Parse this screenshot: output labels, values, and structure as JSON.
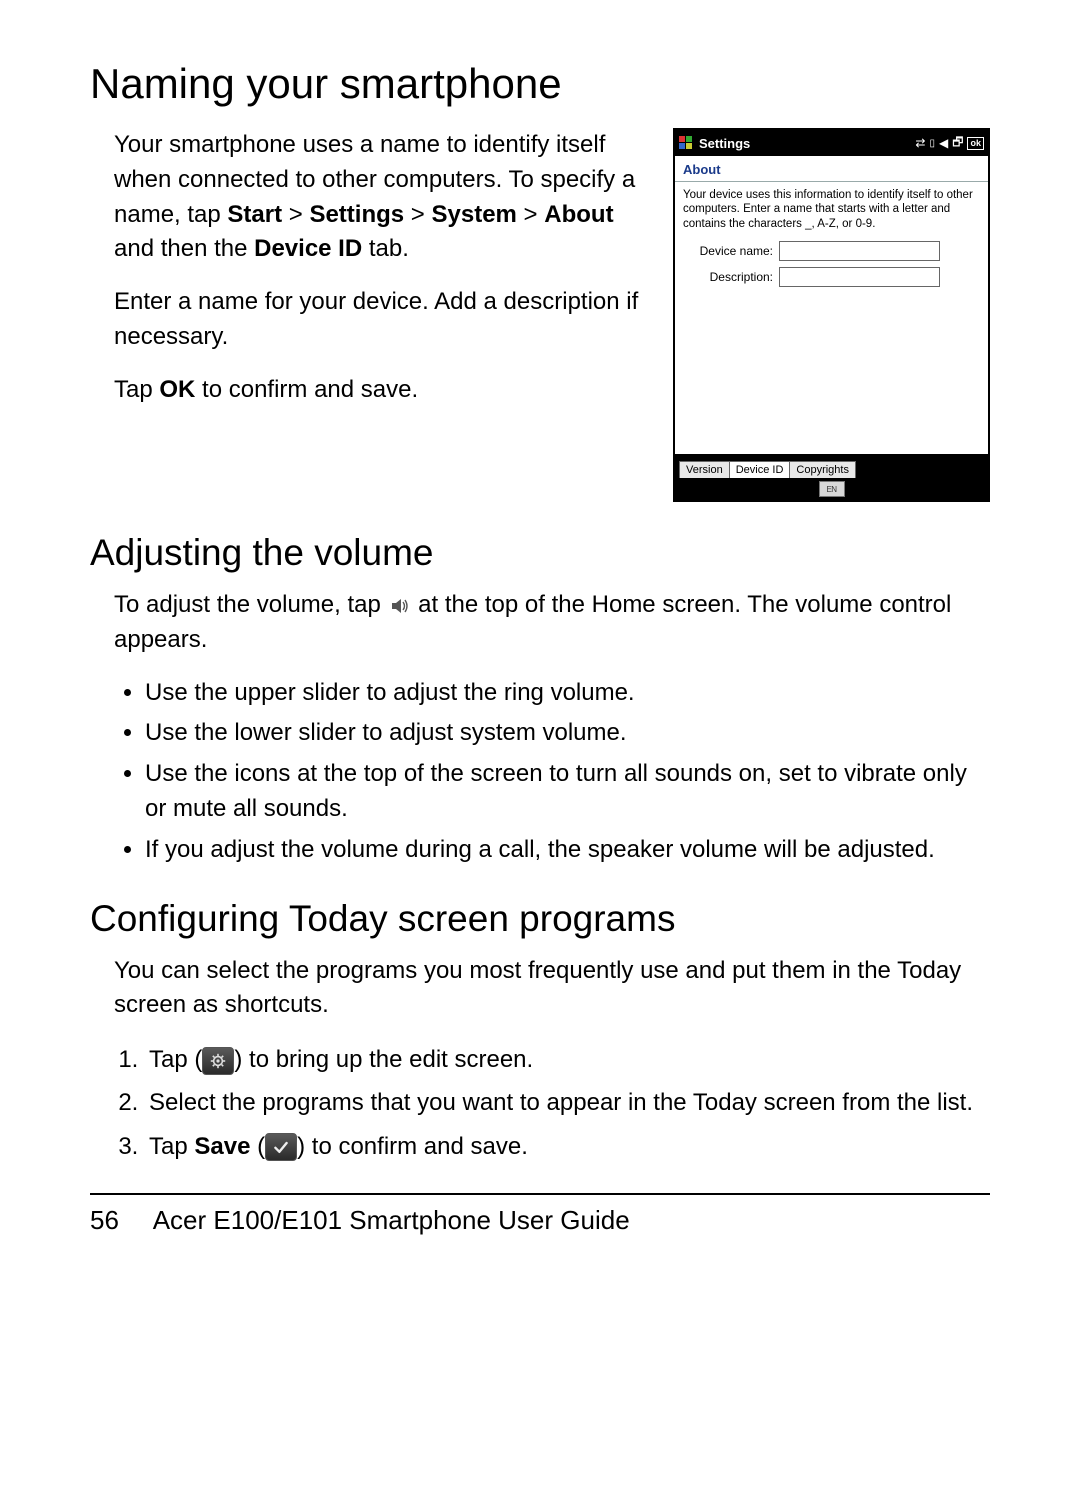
{
  "section_naming": {
    "heading": "Naming your smartphone",
    "para1_pre": "Your smartphone uses a name to identify itself when connected to other computers. To specify a name, tap ",
    "bold_start": "Start",
    "mid1": " > ",
    "bold_settings": "Settings",
    "mid2": " > ",
    "bold_system": "System",
    "mid3": " > ",
    "bold_about": "About",
    "mid4": " and then the ",
    "bold_deviceid": "Device ID",
    "para1_post": " tab.",
    "para2": "Enter a name for your device. Add a description if necessary.",
    "para3_pre": "Tap ",
    "para3_bold": "OK",
    "para3_post": " to confirm and save."
  },
  "wm": {
    "title": "Settings",
    "ok": "ok",
    "about": "About",
    "desc": "Your device uses this information to identify itself to other computers. Enter a name that starts with a letter and contains the characters _, A-Z, or 0-9.",
    "device_name_label": "Device name:",
    "description_label": "Description:",
    "device_name_value": "",
    "description_value": "",
    "tab_version": "Version",
    "tab_deviceid": "Device ID",
    "tab_copyrights": "Copyrights",
    "sip": "EN"
  },
  "section_volume": {
    "heading": "Adjusting the volume",
    "para_pre": "To adjust the volume, tap ",
    "para_post": " at the top of the Home screen. The volume control appears.",
    "bullets": [
      "Use the upper slider to adjust the ring volume.",
      "Use the lower slider to adjust system volume.",
      "Use the icons at the top of the screen to turn all sounds on, set to vibrate only or mute all sounds.",
      "If you adjust the volume during a call, the speaker volume will be adjusted."
    ]
  },
  "section_today": {
    "heading": "Configuring Today screen programs",
    "intro": "You can select the programs you most frequently use and put them in the Today screen as shortcuts.",
    "step1_pre": "Tap (",
    "step1_post": ") to bring up the edit screen.",
    "step2": "Select the programs that you want to appear in the Today screen from the list.",
    "step3_pre": "Tap ",
    "step3_bold": "Save",
    "step3_mid": " (",
    "step3_post": ") to confirm and save."
  },
  "footer": {
    "page": "56",
    "title": "Acer E100/E101 Smartphone User Guide"
  }
}
